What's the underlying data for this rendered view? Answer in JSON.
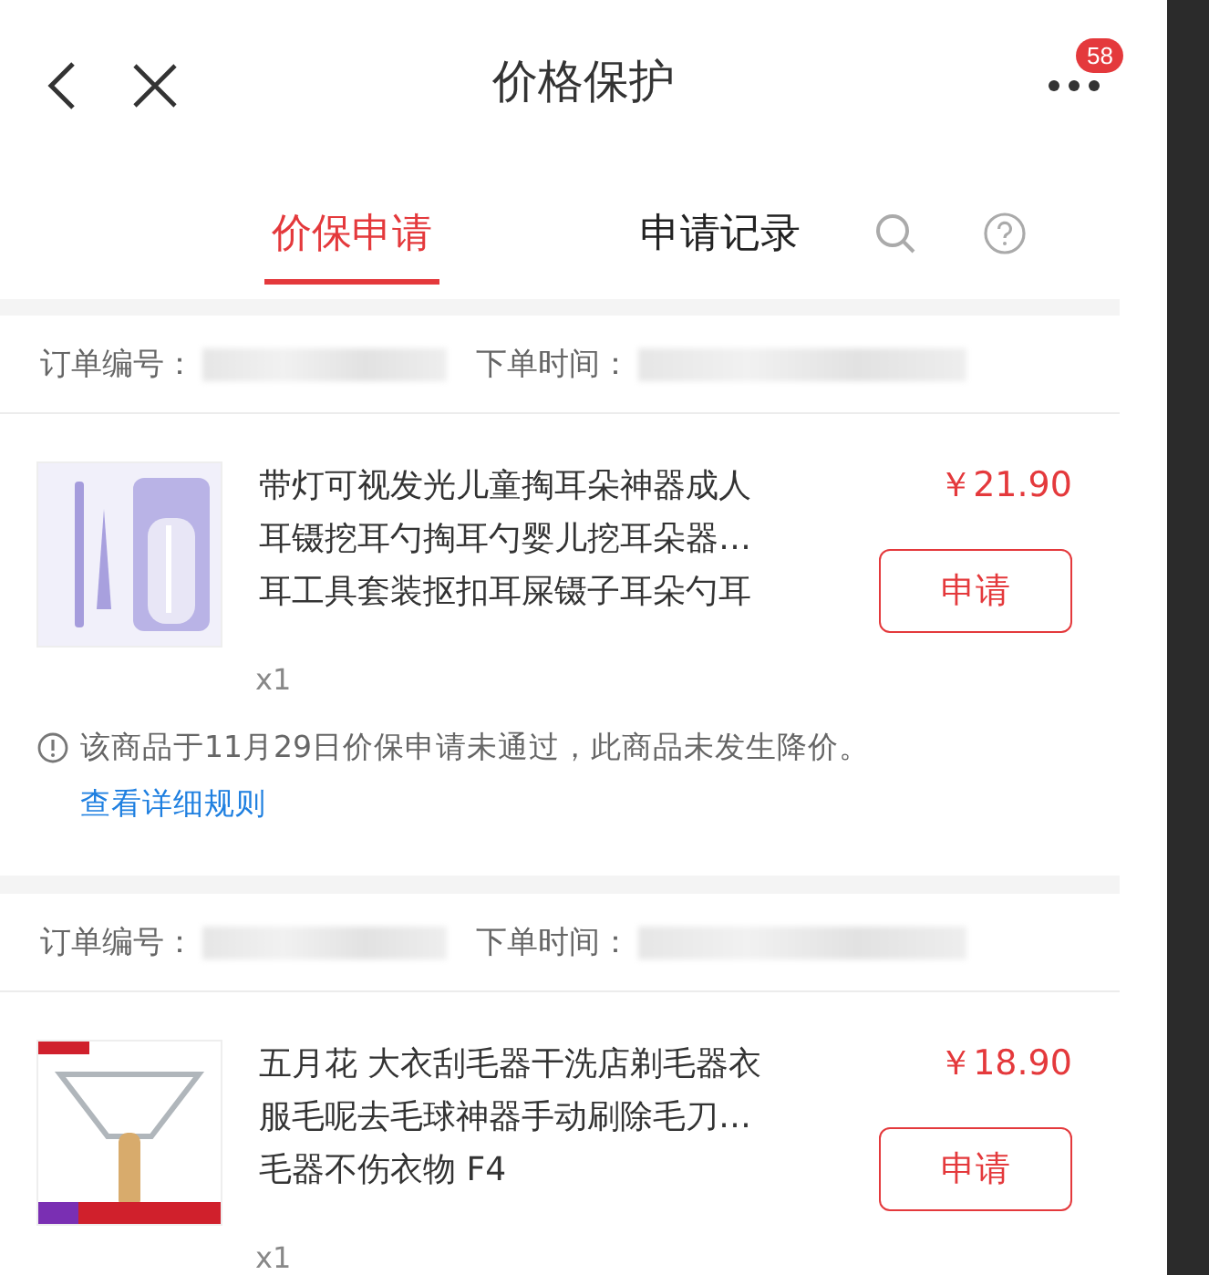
{
  "header": {
    "title": "价格保护",
    "badge": "58"
  },
  "tabs": [
    {
      "label": "价保申请",
      "selected": true
    },
    {
      "label": "申请记录",
      "selected": false
    }
  ],
  "orders": [
    {
      "order_label": "订单编号：",
      "time_label": "下单时间：",
      "title_lines": [
        "带灯可视发光儿童掏耳朵神器成人",
        "耳镊挖耳勺掏耳勺婴儿挖耳朵器…",
        "耳工具套装抠扣耳屎镊子耳朵勺耳"
      ],
      "price": "￥21.90",
      "button": "申请",
      "quantity": "x1",
      "note": {
        "text": "该商品于11月29日价保申请未通过，此商品未发生降价。",
        "link": "查看详细规则"
      }
    },
    {
      "order_label": "订单编号：",
      "time_label": "下单时间：",
      "title_lines": [
        "五月花 大衣刮毛器干洗店剃毛器衣",
        "服毛呢去毛球神器手动刷除毛刀…",
        "毛器不伤衣物 F4"
      ],
      "price": "￥18.90",
      "button": "申请",
      "quantity": "x1"
    }
  ]
}
